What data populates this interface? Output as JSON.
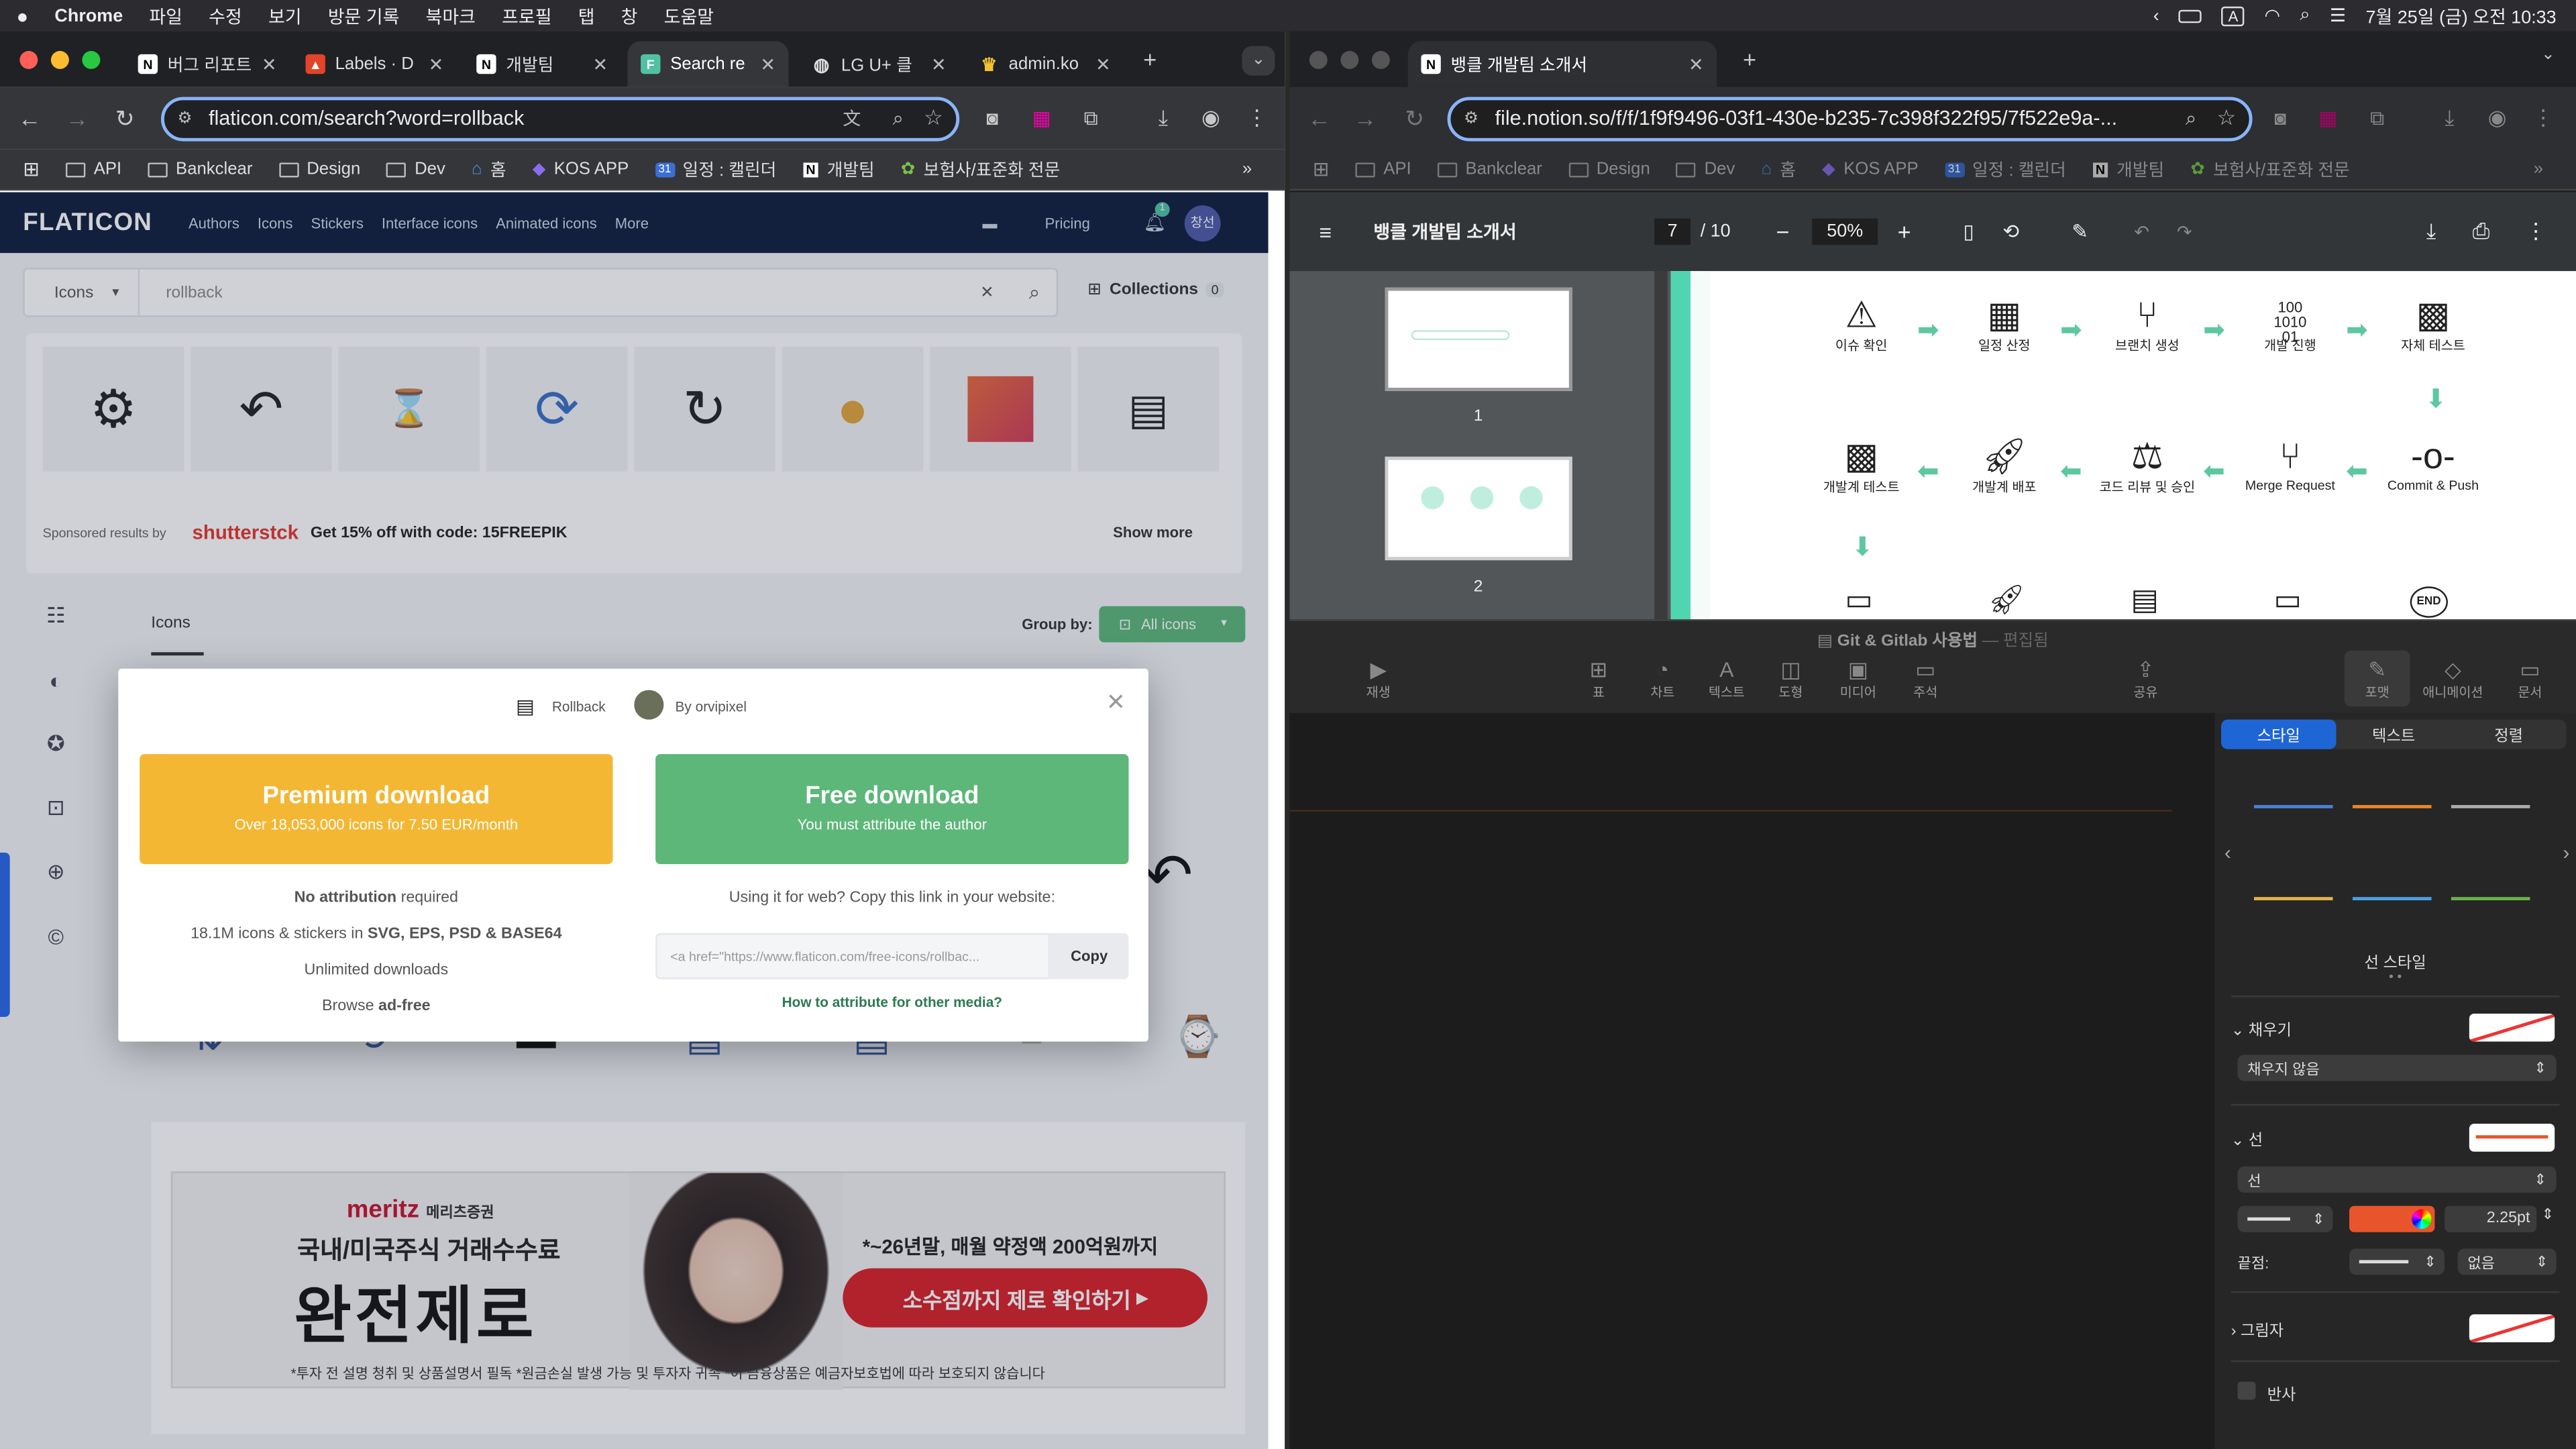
{
  "menubar": {
    "app": "Chrome",
    "items": [
      "파일",
      "수정",
      "보기",
      "방문 기록",
      "북마크",
      "프로필",
      "탭",
      "창",
      "도움말"
    ],
    "datetime": "7월 25일 (금) 오전 10:33",
    "input_mode": "A"
  },
  "left_browser": {
    "tabs": [
      {
        "label": "버그 리포트",
        "icon": "notion-icon"
      },
      {
        "label": "Labels · D",
        "icon": "gitlab-icon"
      },
      {
        "label": "개발팀",
        "icon": "notion-icon"
      },
      {
        "label": "Search re",
        "icon": "flaticon-icon"
      },
      {
        "label": "LG U+ 클",
        "icon": "globe-icon"
      },
      {
        "label": "admin.ko",
        "icon": "crown-icon"
      }
    ],
    "url": "flaticon.com/search?word=rollback",
    "bookmarks": [
      "API",
      "Bankclear",
      "Design",
      "Dev",
      "홈",
      "KOS APP",
      "일정 : 캘린더",
      "개발팀",
      "보험사/표준화 전문"
    ],
    "calendar_badge": "31"
  },
  "flaticon": {
    "logo": "FLATICON",
    "nav": [
      "Authors",
      "Icons",
      "Stickers",
      "Interface icons",
      "Animated icons",
      "More"
    ],
    "pricing": "Pricing",
    "notif_count": "1",
    "avatar": "창선",
    "search_type": "Icons",
    "search_query": "rollback",
    "collections_label": "Collections",
    "collections_count": "0",
    "sponsored_label": "Sponsored results by",
    "shutterstock": "shutterstck",
    "promo": "Get 15% off with code: 15FREEPIK",
    "show_more": "Show more",
    "icons_tab": "Icons",
    "group_by": "Group by:",
    "all_icons": "All icons",
    "ad": {
      "brand": "meritz",
      "brand_kr": "메리츠증권",
      "line1": "국내/미국주식 거래수수료",
      "big": "완전제로",
      "headline": "*~26년말, 매월 약정액 200억원까지",
      "cta": "소수점까지 제로 확인하기",
      "disclaimer": "*투자 전 설명 청취 및 상품설명서 필독 *원금손실 발생 가능 및 투자자 귀속 *이 금융상품은 예금자보호법에 따라 보호되지 않습니다"
    }
  },
  "modal": {
    "icon_name": "Rollback",
    "author": "By orvipixel",
    "premium_title": "Premium download",
    "premium_sub": "Over 18,053,000 icons for 7.50 EUR/month",
    "free_title": "Free download",
    "free_sub": "You must attribute the author",
    "no_attr": "No attribution",
    "no_attr_rest": "required",
    "formats_pre": "18.1M icons & stickers in",
    "formats": "SVG, EPS, PSD & BASE64",
    "unlimited": "Unlimited downloads",
    "browse": "Browse",
    "adfree": "ad-free",
    "web_copy": "Using it for web? Copy this link in your website:",
    "link_value": "<a href=\"https://www.flaticon.com/free-icons/rollbac...",
    "copy_btn": "Copy",
    "other_media": "How to attribute for other media?"
  },
  "right_browser": {
    "tab_label": "뱅클 개발팀 소개서",
    "url": "file.notion.so/f/f/1f9f9496-03f1-430e-b235-7c398f322f95/7f522e9a-...",
    "bookmarks": [
      "API",
      "Bankclear",
      "Design",
      "Dev",
      "홈",
      "KOS APP",
      "일정 : 캘린더",
      "개발팀",
      "보험사/표준화 전문"
    ],
    "calendar_badge": "31"
  },
  "pdf": {
    "title": "뱅클 개발팀 소개서",
    "page": "7",
    "total": "/ 10",
    "zoom": "50%",
    "thumbs": [
      "1",
      "2"
    ],
    "flow_row1": [
      "이슈 확인",
      "일정 산정",
      "브랜치 생성",
      "개발 진행",
      "자체 테스트"
    ],
    "flow_row2": [
      "개발계 테스트",
      "개발계 배포",
      "코드 리뷰 및 승인",
      "Merge Request",
      "Commit & Push"
    ],
    "end_label": "END"
  },
  "keynote": {
    "title": "Git & Gitlab 사용법",
    "title_suffix": "— 편집됨",
    "toolbar": [
      "재생",
      "표",
      "차트",
      "텍스트",
      "도형",
      "미디어",
      "주석",
      "공유",
      "포맷",
      "애니메이션",
      "문서"
    ],
    "inspector_tabs": [
      "스타일",
      "텍스트",
      "정렬"
    ],
    "line_style_label": "선 스타일",
    "fill_label": "채우기",
    "fill_value": "채우지 않음",
    "stroke_label": "선",
    "stroke_value": "선",
    "stroke_width": "2.25pt",
    "endpoints_label": "끝점:",
    "endpoint_value": "없음",
    "shadow_label": "그림자",
    "reflection_label": "반사",
    "stroke_color": "#e8552b",
    "line_swatches": [
      "#4a7fd4",
      "#e8852b",
      "#aaaaaa",
      "#e0b24a",
      "#4a9fe0",
      "#6ab04c"
    ]
  },
  "colors": {
    "premium": "#f4b733",
    "free": "#5cb779",
    "flaticon_nav": "#0e1d3b",
    "accent_blue": "#8ab4f8",
    "pdf_green": "#5dc7a0"
  }
}
